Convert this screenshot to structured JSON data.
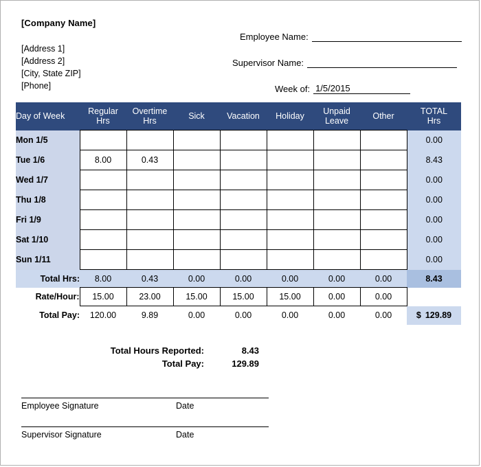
{
  "header": {
    "company_name": "[Company Name]",
    "address_line1": "[Address 1]",
    "address_line2": "[Address 2]",
    "address_line3": "[City, State  ZIP]",
    "address_line4": "[Phone]",
    "employee_name_label": "Employee Name:",
    "employee_name_value": "",
    "supervisor_name_label": "Supervisor Name:",
    "supervisor_name_value": "",
    "week_of_label": "Week of:",
    "week_of_value": "1/5/2015"
  },
  "table": {
    "columns": [
      "Day of Week",
      "Regular\nHrs",
      "Overtime\nHrs",
      "Sick",
      "Vacation",
      "Holiday",
      "Unpaid\nLeave",
      "Other",
      "TOTAL\nHrs"
    ],
    "columns_flat": {
      "day": "Day of Week",
      "regular_1": "Regular",
      "regular_2": "Hrs",
      "overtime_1": "Overtime",
      "overtime_2": "Hrs",
      "sick": "Sick",
      "vacation": "Vacation",
      "holiday": "Holiday",
      "unpaid_1": "Unpaid",
      "unpaid_2": "Leave",
      "other": "Other",
      "total_1": "TOTAL",
      "total_2": "Hrs"
    },
    "rows": [
      {
        "day": "Mon 1/5",
        "regular": "",
        "overtime": "",
        "sick": "",
        "vacation": "",
        "holiday": "",
        "unpaid": "",
        "other": "",
        "total": "0.00"
      },
      {
        "day": "Tue 1/6",
        "regular": "8.00",
        "overtime": "0.43",
        "sick": "",
        "vacation": "",
        "holiday": "",
        "unpaid": "",
        "other": "",
        "total": "8.43"
      },
      {
        "day": "Wed 1/7",
        "regular": "",
        "overtime": "",
        "sick": "",
        "vacation": "",
        "holiday": "",
        "unpaid": "",
        "other": "",
        "total": "0.00"
      },
      {
        "day": "Thu 1/8",
        "regular": "",
        "overtime": "",
        "sick": "",
        "vacation": "",
        "holiday": "",
        "unpaid": "",
        "other": "",
        "total": "0.00"
      },
      {
        "day": "Fri 1/9",
        "regular": "",
        "overtime": "",
        "sick": "",
        "vacation": "",
        "holiday": "",
        "unpaid": "",
        "other": "",
        "total": "0.00"
      },
      {
        "day": "Sat 1/10",
        "regular": "",
        "overtime": "",
        "sick": "",
        "vacation": "",
        "holiday": "",
        "unpaid": "",
        "other": "",
        "total": "0.00"
      },
      {
        "day": "Sun 1/11",
        "regular": "",
        "overtime": "",
        "sick": "",
        "vacation": "",
        "holiday": "",
        "unpaid": "",
        "other": "",
        "total": "0.00"
      }
    ],
    "total_hours_row": {
      "label": "Total Hrs:",
      "regular": "8.00",
      "overtime": "0.43",
      "sick": "0.00",
      "vacation": "0.00",
      "holiday": "0.00",
      "unpaid": "0.00",
      "other": "0.00",
      "total": "8.43"
    },
    "rate_row": {
      "label": "Rate/Hour:",
      "regular": "15.00",
      "overtime": "23.00",
      "sick": "15.00",
      "vacation": "15.00",
      "holiday": "15.00",
      "unpaid": "0.00",
      "other": "0.00",
      "total": ""
    },
    "total_pay_row": {
      "label": "Total Pay:",
      "regular": "120.00",
      "overtime": "9.89",
      "sick": "0.00",
      "vacation": "0.00",
      "holiday": "0.00",
      "unpaid": "0.00",
      "other": "0.00",
      "currency": "$",
      "total": "129.89"
    }
  },
  "summary": {
    "total_hours_label": "Total Hours Reported:",
    "total_hours_value": "8.43",
    "total_pay_label": "Total Pay:",
    "total_pay_value": "129.89"
  },
  "signatures": {
    "employee_label": "Employee Signature",
    "employee_date_label": "Date",
    "supervisor_label": "Supervisor Signature",
    "supervisor_date_label": "Date"
  },
  "colors": {
    "header_navy": "#2f4a7d",
    "day_column_blue": "#ccd6ea",
    "total_column_blue": "#ccd9ee",
    "grand_total_blue": "#a9bfe0",
    "page_border": "#b0b0b0"
  }
}
